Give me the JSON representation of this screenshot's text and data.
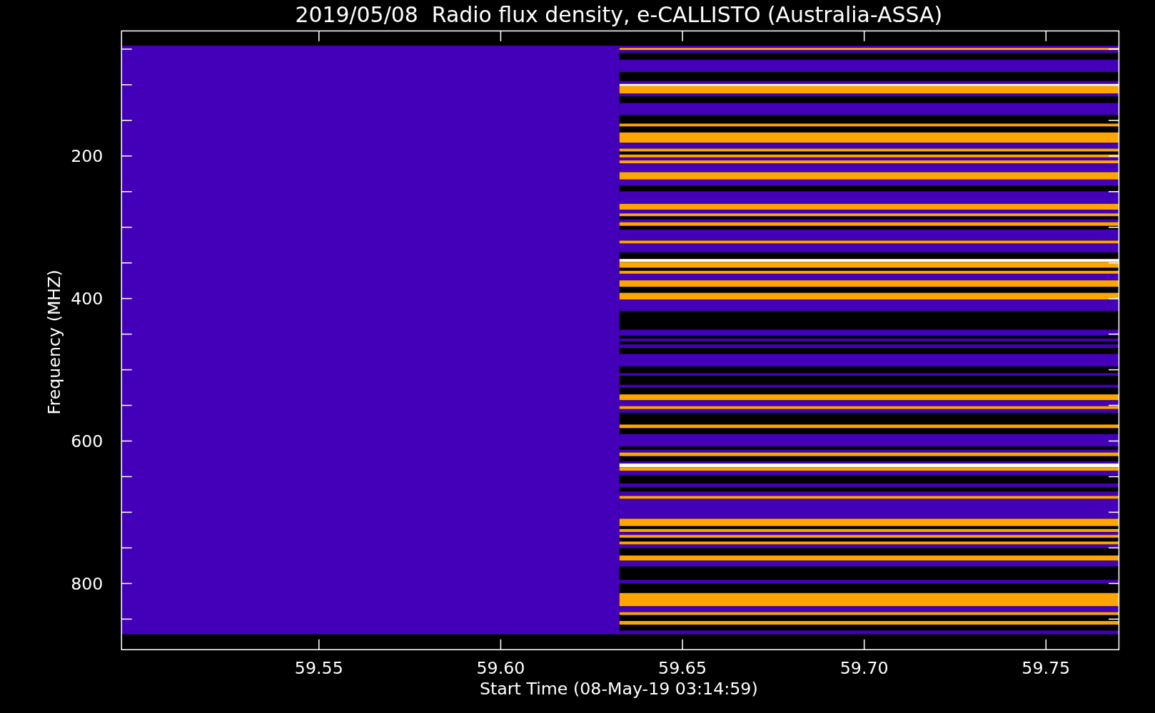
{
  "title": "2019/05/08  Radio flux density, e-CALLISTO (Australia-ASSA)",
  "plot": {
    "ylabel": "Frequency (MHZ)",
    "xlabel": "Start Time (08-May-19 03:14:59)",
    "yticks": [
      "200",
      "400",
      "600",
      "800"
    ],
    "xticks": [
      "59.55",
      "59.60",
      "59.65",
      "59.70",
      "59.75"
    ]
  }
}
